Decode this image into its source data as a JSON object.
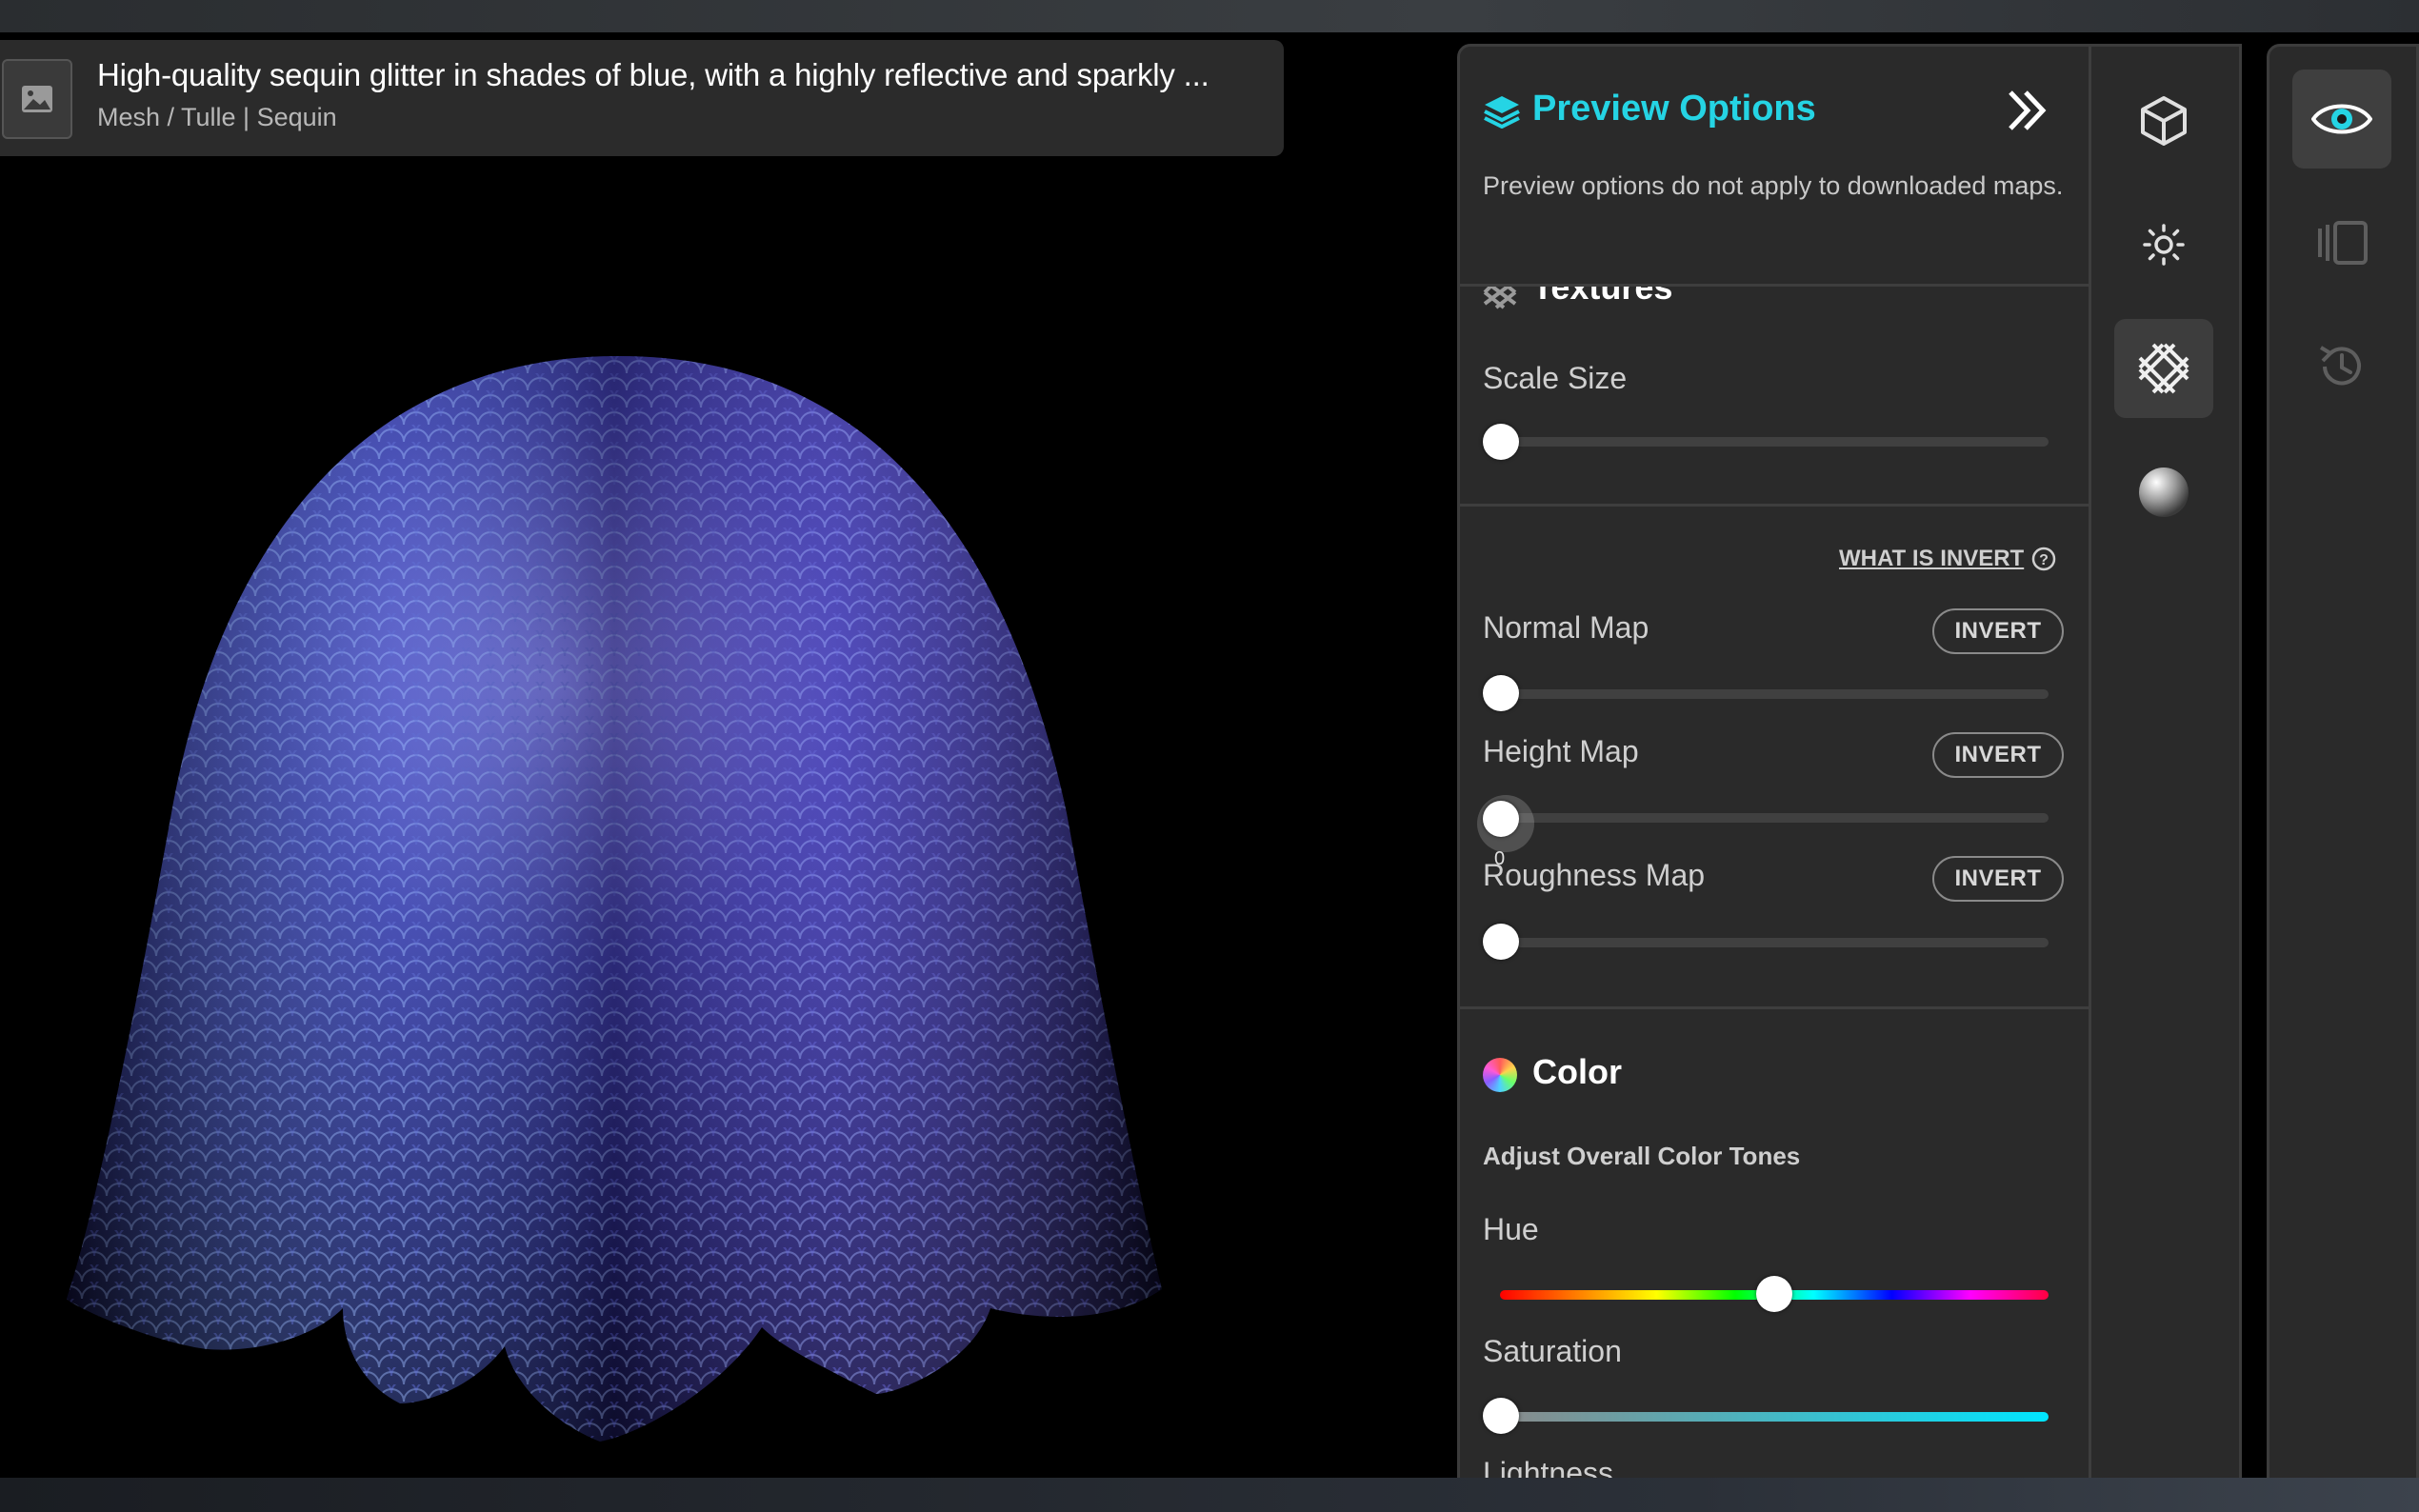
{
  "material": {
    "title": "High-quality sequin glitter in shades of blue, with a highly reflective and sparkly ...",
    "category": "Mesh / Tulle | Sequin"
  },
  "panel": {
    "title": "Preview Options",
    "note": "Preview options do not apply to downloaded maps.",
    "textures": {
      "heading": "Textures",
      "scale_label": "Scale Size",
      "scale_value": 0
    },
    "maps": {
      "what_is_invert": "WHAT IS INVERT",
      "items": [
        {
          "label": "Normal Map",
          "button": "INVERT",
          "value": 0
        },
        {
          "label": "Height Map",
          "button": "INVERT",
          "value": 0,
          "tooltip": "0"
        },
        {
          "label": "Roughness Map",
          "button": "INVERT",
          "value": 0
        }
      ]
    },
    "color": {
      "heading": "Color",
      "subheading": "Adjust Overall Color Tones",
      "hue_label": "Hue",
      "hue_value": 0.5,
      "saturation_label": "Saturation",
      "saturation_value": 0,
      "lightness_label": "Lightness"
    }
  },
  "rail_icons": [
    "cube-icon",
    "sun-icon",
    "texture-grid-icon",
    "sphere-icon"
  ],
  "rightbar_icons": [
    "eye-icon",
    "split-view-icon",
    "history-icon"
  ],
  "colors": {
    "accent": "#25d4e4",
    "panel": "#2a2a2a"
  }
}
